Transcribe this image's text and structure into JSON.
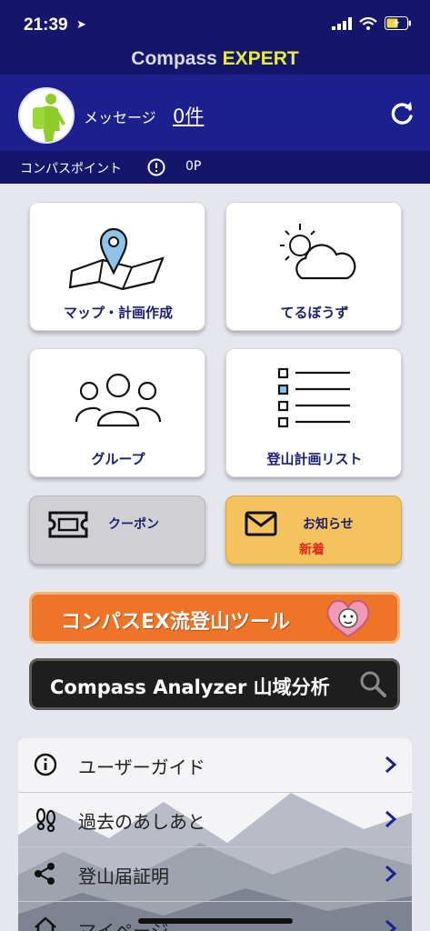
{
  "status_bar": {
    "time": "21:39"
  },
  "app": {
    "name_part1": "Compass",
    "name_part2": "EXPERT"
  },
  "profile": {
    "message_label": "メッセージ",
    "message_count": "0件"
  },
  "points": {
    "label": "コンパスポイント",
    "value": "0P"
  },
  "tiles": [
    {
      "label": "マップ・計画作成",
      "icon": "map-pin-icon"
    },
    {
      "label": "てるぼうず",
      "icon": "weather-icon"
    },
    {
      "label": "グループ",
      "icon": "group-icon"
    },
    {
      "label": "登山計画リスト",
      "icon": "list-icon"
    }
  ],
  "coupon": {
    "label": "クーポン"
  },
  "notice": {
    "label": "お知らせ",
    "badge": "新着"
  },
  "banners": {
    "tool": "コンパスEX流登山ツール",
    "analyzer": "Compass Analyzer 山域分析"
  },
  "menu": [
    {
      "label": "ユーザーガイド",
      "icon": "info-icon"
    },
    {
      "label": "過去のあしあと",
      "icon": "footprints-icon"
    },
    {
      "label": "登山届証明",
      "icon": "share-icon"
    },
    {
      "label": "マイページ",
      "icon": "home-icon"
    }
  ],
  "colors": {
    "header": "#14166b",
    "profile": "#1c1f8e",
    "accent_yellow": "#e6ec3c",
    "tile_text": "#1b1f6e",
    "coupon_bg": "#cfcfd4",
    "notice_bg": "#f5c35e",
    "new_badge": "#e52a1a",
    "orange_banner": "#ee7428"
  }
}
